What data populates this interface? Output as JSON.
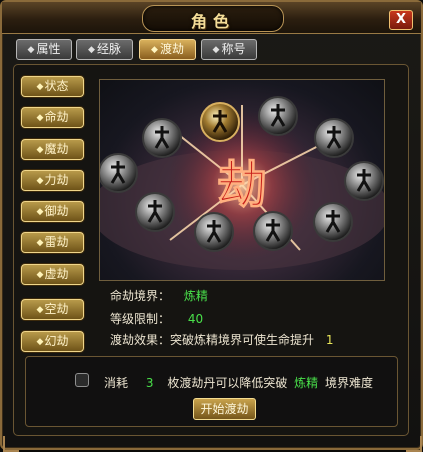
{
  "window": {
    "title": "角色",
    "close_label": "X"
  },
  "tabs": [
    {
      "label": "属性",
      "active": false
    },
    {
      "label": "经脉",
      "active": false
    },
    {
      "label": "渡劫",
      "active": true
    },
    {
      "label": "称号",
      "active": false
    }
  ],
  "side_menu": [
    "状态",
    "命劫",
    "魔劫",
    "力劫",
    "御劫",
    "雷劫",
    "虚劫",
    "空劫",
    "幻劫"
  ],
  "scene": {
    "center_glyph": "劫",
    "figure_count": 10
  },
  "info": {
    "realm_label": "命劫境界：",
    "realm_value": "炼精",
    "level_label": "等级限制：",
    "level_value": "40",
    "effect_label": "渡劫效果：突破炼精境界可使生命提升",
    "effect_value": "1"
  },
  "consume": {
    "prefix": "消耗",
    "count": "3",
    "middle": "枚渡劫丹可以降低突破",
    "realm": "炼精",
    "suffix": "境界难度"
  },
  "start_button": "开始渡劫",
  "colors": {
    "accent_gold": "#d9b15c",
    "value_green": "#49e04a",
    "value_yellow": "#e9e65a",
    "glyph_red": "#c8201a"
  }
}
